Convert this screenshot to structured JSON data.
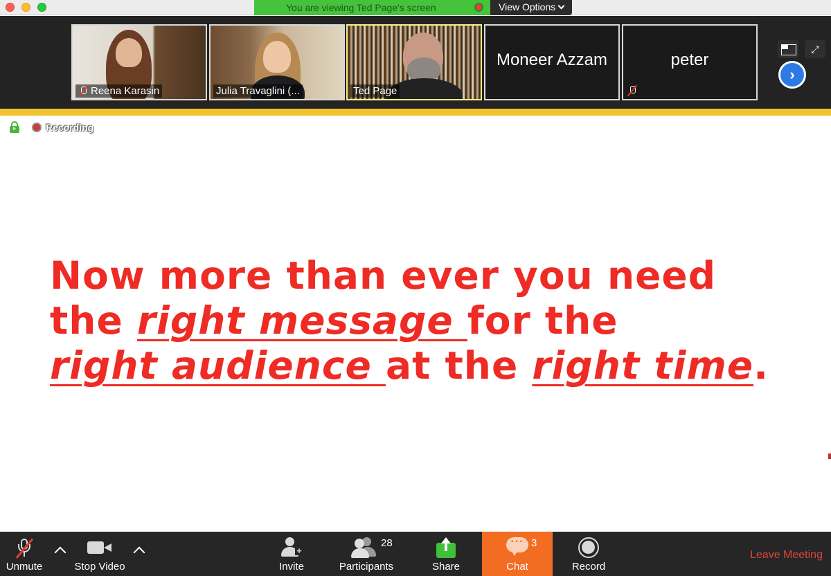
{
  "window": {
    "share_banner": "You are viewing Ted Page's screen",
    "view_options": "View Options"
  },
  "gallery": {
    "participants": [
      {
        "name": "Reena Karasin",
        "muted": true,
        "video": true
      },
      {
        "name": "Julia Travaglini (...",
        "muted": false,
        "video": true
      },
      {
        "name": "Ted Page",
        "muted": false,
        "video": true,
        "active_speaker": true
      },
      {
        "name": "Moneer Azzam",
        "muted": false,
        "video": false
      },
      {
        "name": "peter",
        "muted": true,
        "video": false
      }
    ]
  },
  "indicators": {
    "encryption_letter": "E",
    "recording_label": "Recording"
  },
  "slide": {
    "line1": "Now more than ever you need",
    "line2_pre": "the ",
    "line2_em": "right message ",
    "line2_post": "for the",
    "line3_em1": "right audience ",
    "line3_mid": "at the ",
    "line3_em2": "right time",
    "line3_end": ".",
    "text_color": "#ee2b24"
  },
  "toolbar": {
    "unmute": "Unmute",
    "stop_video": "Stop Video",
    "invite": "Invite",
    "participants": "Participants",
    "participants_count": "28",
    "share": "Share",
    "chat": "Chat",
    "chat_badge": "3",
    "record": "Record",
    "leave": "Leave Meeting",
    "accent_chat": "#f26d21",
    "leave_color": "#e0453a"
  }
}
